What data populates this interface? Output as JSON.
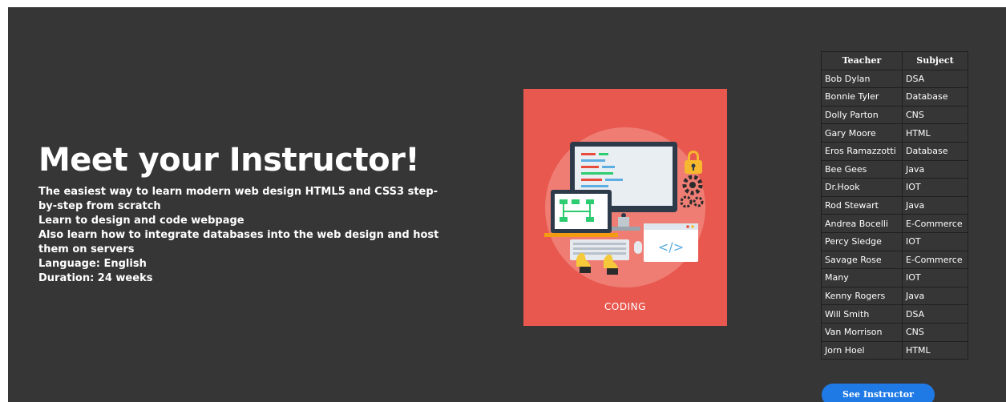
{
  "instructor": {
    "heading": "Meet your Instructor!",
    "lines": [
      "The easiest way to learn modern web design HTML5 and CSS3 step-by-step from scratch",
      "Learn to design and code webpage",
      "Also learn how to integrate databases into the web design and host them on servers",
      "Language: English",
      "Duration: 24 weeks"
    ]
  },
  "illustration": {
    "caption": "CODING",
    "code_symbol": "</>",
    "colors": {
      "background": "#e8584f",
      "circle": "#ef7d74",
      "monitor": "#2d3a4a",
      "screen": "#e9eef3",
      "lock": "#f5b82e",
      "gear": "#2b2b2b",
      "hands": "#f5c93a",
      "green_chart": "#2ecc71"
    }
  },
  "table": {
    "headers": [
      "Teacher",
      "Subject"
    ],
    "rows": [
      [
        "Bob Dylan",
        "DSA"
      ],
      [
        "Bonnie Tyler",
        "Database"
      ],
      [
        "Dolly Parton",
        "CNS"
      ],
      [
        "Gary Moore",
        "HTML"
      ],
      [
        "Eros Ramazzotti",
        "Database"
      ],
      [
        "Bee Gees",
        "Java"
      ],
      [
        "Dr.Hook",
        "IOT"
      ],
      [
        "Rod Stewart",
        "Java"
      ],
      [
        "Andrea Bocelli",
        "E-Commerce"
      ],
      [
        "Percy Sledge",
        "IOT"
      ],
      [
        "Savage Rose",
        "E-Commerce"
      ],
      [
        "Many",
        "IOT"
      ],
      [
        "Kenny Rogers",
        "Java"
      ],
      [
        "Will Smith",
        "DSA"
      ],
      [
        "Van Morrison",
        "CNS"
      ],
      [
        "Jorn Hoel",
        "HTML"
      ]
    ]
  },
  "actions": {
    "see_instructor": "See Instructor"
  },
  "colors": {
    "page_background": "#363636",
    "button": "#1f7ae6",
    "text": "#ffffff"
  }
}
